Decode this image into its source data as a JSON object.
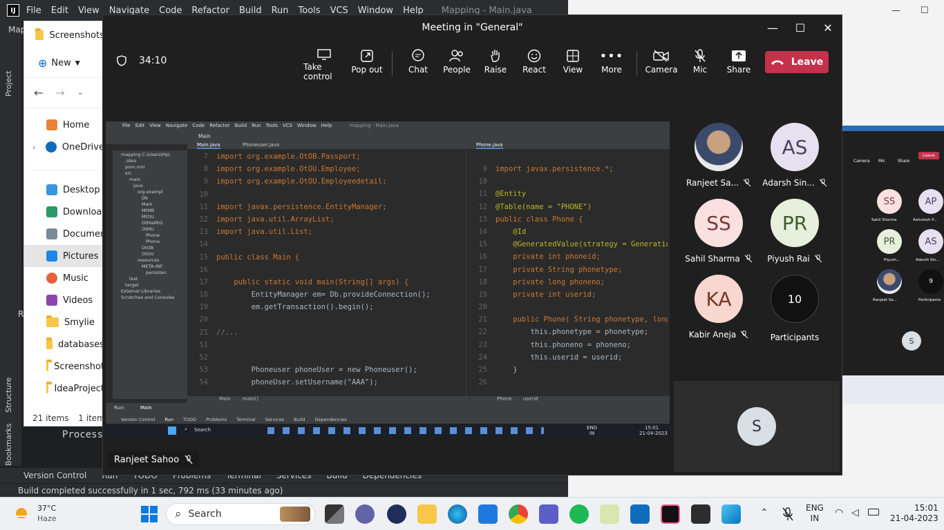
{
  "intellij": {
    "menu": [
      "File",
      "Edit",
      "View",
      "Navigate",
      "Code",
      "Refactor",
      "Build",
      "Run",
      "Tools",
      "VCS",
      "Window",
      "Help"
    ],
    "title": "Mapping - Main.java",
    "left_tabs": [
      "Project",
      "Structure",
      "Bookmarks"
    ],
    "bottom_tabs": [
      "Version Control",
      "Run",
      "TODO",
      "Problems",
      "Terminal",
      "Services",
      "Build",
      "Dependencies"
    ],
    "status": "Build completed successfully in 1 sec, 792 ms (33 minutes ago)",
    "side_label": "Map",
    "side_letter": "R",
    "process_text": "Process"
  },
  "explorer": {
    "title": "Screenshots",
    "new_label": "New",
    "nav": [
      "Home",
      "OneDrive",
      "Desktop",
      "Downloads",
      "Documents",
      "Pictures",
      "Music",
      "Videos",
      "Smylie",
      "databases",
      "Screenshot",
      "IdeaProject"
    ],
    "selected": "Pictures",
    "items_count": "21 items",
    "selected_count": "1 item"
  },
  "teams": {
    "title": "Meeting in \"General\"",
    "timer": "34:10",
    "toolbar": [
      "Take control",
      "Pop out",
      "Chat",
      "People",
      "Raise",
      "React",
      "View",
      "More",
      "Camera",
      "Mic",
      "Share"
    ],
    "leave": "Leave",
    "presenter": "Ranjeet Sahoo",
    "participants": [
      {
        "initials": "",
        "name": "Ranjeet Sa...",
        "color": "#ffffff"
      },
      {
        "initials": "AS",
        "name": "Adarsh Sin...",
        "color": "#e6e0f0"
      },
      {
        "initials": "SS",
        "name": "Sahil Sharma",
        "color": "#fbe0e0"
      },
      {
        "initials": "PR",
        "name": "Piyush Rai",
        "color": "#e7f0dc"
      },
      {
        "initials": "KA",
        "name": "Kabir Aneja",
        "color": "#f7d7cf"
      },
      {
        "initials": "10",
        "name": "Participants",
        "color": "#111111"
      }
    ],
    "self_initial": "S"
  },
  "shared_screen": {
    "menu": [
      "File",
      "Edit",
      "View",
      "Navigate",
      "Code",
      "Refactor",
      "Build",
      "Run",
      "Tools",
      "VCS",
      "Window",
      "Help"
    ],
    "title": "mapping - Main.java",
    "run_config": "Main",
    "tabs_left": [
      "Main.java",
      "Phoneuser.java"
    ],
    "tab_right": "Phone.java",
    "tree": [
      "mapping C:\\Users\\Hp\\",
      ".idea",
      "pom.xml",
      "src",
      "main",
      "java",
      "org.exampl",
      "Db",
      "Main",
      "MtMB",
      "MtOU",
      "OtMaMtO",
      "OtMU",
      "Phone",
      "Phone",
      "OtOB",
      "OtOU",
      "resources",
      "META-INF",
      "persisten",
      "test",
      "target",
      "External Libraries",
      "Scratches and Consoles"
    ],
    "left_code": [
      {
        "n": "7",
        "t": "import org.example.OtOB.Passport;"
      },
      {
        "n": "8",
        "t": "import org.example.OtOU.Employee;"
      },
      {
        "n": "9",
        "t": "import org.example.OtOU.Employeedetail;"
      },
      {
        "n": "10",
        "t": ""
      },
      {
        "n": "11",
        "t": "import javax.persistence.EntityManager;"
      },
      {
        "n": "12",
        "t": "import java.util.ArrayList;"
      },
      {
        "n": "13",
        "t": "import java.util.List;"
      },
      {
        "n": "14",
        "t": ""
      },
      {
        "n": "15",
        "t": "public class Main {"
      },
      {
        "n": "16",
        "t": ""
      },
      {
        "n": "17",
        "t": "    public static void main(String[] args) {"
      },
      {
        "n": "18",
        "t": "        EntityManager em= Db.provideConnection();"
      },
      {
        "n": "19",
        "t": "        em.getTransaction().begin();"
      },
      {
        "n": "20",
        "t": ""
      },
      {
        "n": "21",
        "t": "//..."
      },
      {
        "n": "51",
        "t": ""
      },
      {
        "n": "52",
        "t": ""
      },
      {
        "n": "53",
        "t": "        Phoneuser phoneUser = new Phoneuser();"
      },
      {
        "n": "54",
        "t": "        phoneUser.setUsername(\"AAA\");"
      }
    ],
    "right_code": [
      {
        "n": "9",
        "t": "import javax.persistence.*;"
      },
      {
        "n": "10",
        "t": ""
      },
      {
        "n": "11",
        "t": "@Entity"
      },
      {
        "n": "12",
        "t": "@Table(name = \"PHONE\")"
      },
      {
        "n": "13",
        "t": "public class Phone {"
      },
      {
        "n": "14",
        "t": "    @Id"
      },
      {
        "n": "15",
        "t": "    @GeneratedValue(strategy = GenerationType.AU"
      },
      {
        "n": "16",
        "t": "    private int phoneid;"
      },
      {
        "n": "17",
        "t": "    private String phonetype;"
      },
      {
        "n": "18",
        "t": "    private long phoneno;"
      },
      {
        "n": "19",
        "t": "    private int userid;"
      },
      {
        "n": "20",
        "t": ""
      },
      {
        "n": "21",
        "t": "    public Phone( String phonetype, long phoneno, i"
      },
      {
        "n": "22",
        "t": "        this.phonetype = phonetype;"
      },
      {
        "n": "23",
        "t": "        this.phoneno = phoneno;"
      },
      {
        "n": "24",
        "t": "        this.userid = userid;"
      },
      {
        "n": "25",
        "t": "    }"
      },
      {
        "n": "26",
        "t": ""
      }
    ],
    "left_breadcrumb": [
      "Main",
      "main()"
    ],
    "right_breadcrumb": [
      "Phone",
      "userid"
    ],
    "run_label": "Run:",
    "run_tab": "Main",
    "bottom_tabs": [
      "Version Control",
      "Run",
      "TODO",
      "Problems",
      "Terminal",
      "Services",
      "Build",
      "Dependencies"
    ],
    "search": "Search",
    "lang": "ENG",
    "lang2": "IN",
    "time": "15:01",
    "date": "21-04-2023",
    "mini_participants": [
      "SS",
      "AP",
      "PR",
      "AS",
      "9"
    ],
    "mini_names": [
      "Sahil Sharma",
      "Ashutosh P...",
      "Piyush...",
      "Adarsh Sin...",
      "Ranjeet Sa...",
      "Participants"
    ],
    "mini_toolbar": [
      "Camera",
      "Mic",
      "Share",
      "Leave"
    ],
    "mini_self": "S"
  },
  "weather": {
    "temp": "37°C",
    "desc": "Haze"
  },
  "taskbar": {
    "search": "Search",
    "lang": "ENG",
    "lang2": "IN",
    "time": "15:01",
    "date": "21-04-2023"
  },
  "colors": {
    "leave": "#c4314b",
    "teams_bg": "#1f1f1f",
    "ide_bg": "#2b2b2b"
  }
}
